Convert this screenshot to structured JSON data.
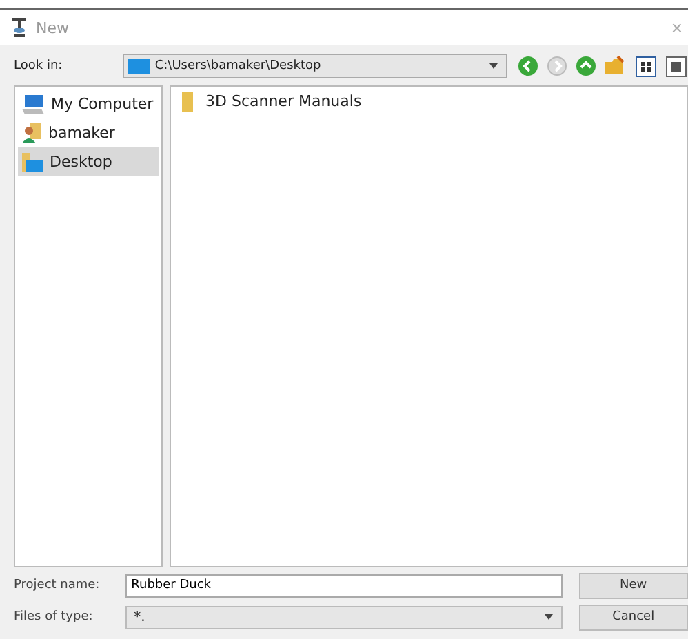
{
  "window": {
    "title": "New",
    "close": "×"
  },
  "look_in": {
    "label": "Look in:",
    "path": "C:\\Users\\bamaker\\Desktop"
  },
  "sidebar": {
    "items": [
      {
        "label": "My Computer",
        "kind": "computer",
        "selected": false
      },
      {
        "label": "bamaker",
        "kind": "user",
        "selected": false
      },
      {
        "label": "Desktop",
        "kind": "desktop",
        "selected": true
      }
    ]
  },
  "files": [
    {
      "name": "3D Scanner Manuals",
      "kind": "folder"
    }
  ],
  "project_name": {
    "label": "Project name:",
    "value": "Rubber Duck"
  },
  "files_of_type": {
    "label": "Files of type:",
    "value": "*."
  },
  "buttons": [
    "New",
    "Cancel"
  ]
}
